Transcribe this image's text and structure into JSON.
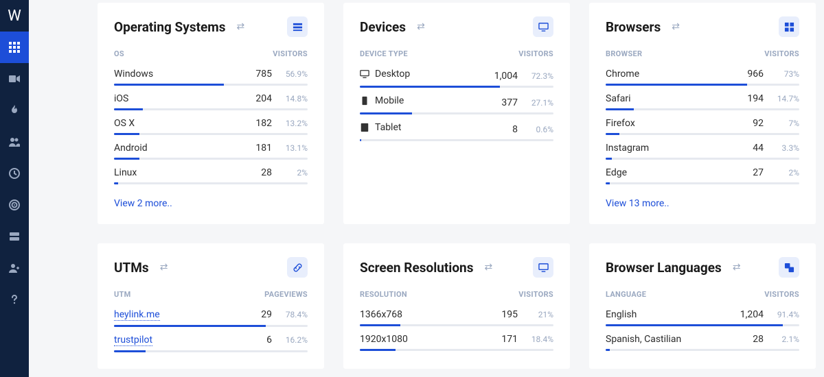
{
  "sidebar": {
    "logo": "W",
    "items": [
      {
        "id": "dashboard",
        "active": true
      },
      {
        "id": "video"
      },
      {
        "id": "fire"
      },
      {
        "id": "users"
      },
      {
        "id": "clock"
      },
      {
        "id": "target"
      },
      {
        "id": "server"
      },
      {
        "id": "user-add"
      },
      {
        "id": "help"
      }
    ]
  },
  "cards": {
    "os": {
      "title": "Operating Systems",
      "col1": "OS",
      "col2": "VISITORS",
      "rows": [
        {
          "label": "Windows",
          "value": "785",
          "pct": "56.9%",
          "w": 56.9
        },
        {
          "label": "iOS",
          "value": "204",
          "pct": "14.8%",
          "w": 14.8
        },
        {
          "label": "OS X",
          "value": "182",
          "pct": "13.2%",
          "w": 13.2
        },
        {
          "label": "Android",
          "value": "181",
          "pct": "13.1%",
          "w": 13.1
        },
        {
          "label": "Linux",
          "value": "28",
          "pct": "2%",
          "w": 2
        }
      ],
      "more": "View 2 more.."
    },
    "devices": {
      "title": "Devices",
      "col1": "DEVICE TYPE",
      "col2": "VISITORS",
      "rows": [
        {
          "label": "Desktop",
          "value": "1,004",
          "pct": "72.3%",
          "w": 72.3,
          "icon": "desktop"
        },
        {
          "label": "Mobile",
          "value": "377",
          "pct": "27.1%",
          "w": 27.1,
          "icon": "mobile"
        },
        {
          "label": "Tablet",
          "value": "8",
          "pct": "0.6%",
          "w": 0.6,
          "icon": "tablet"
        }
      ]
    },
    "browsers": {
      "title": "Browsers",
      "col1": "BROWSER",
      "col2": "VISITORS",
      "rows": [
        {
          "label": "Chrome",
          "value": "966",
          "pct": "73%",
          "w": 73
        },
        {
          "label": "Safari",
          "value": "194",
          "pct": "14.7%",
          "w": 14.7
        },
        {
          "label": "Firefox",
          "value": "92",
          "pct": "7%",
          "w": 7
        },
        {
          "label": "Instagram",
          "value": "44",
          "pct": "3.3%",
          "w": 3.3
        },
        {
          "label": "Edge",
          "value": "27",
          "pct": "2%",
          "w": 2
        }
      ],
      "more": "View 13 more.."
    },
    "utms": {
      "title": "UTMs",
      "col1": "UTM",
      "col2": "PAGEVIEWS",
      "rows": [
        {
          "label": "heylink.me",
          "value": "29",
          "pct": "78.4%",
          "w": 78.4,
          "link": true
        },
        {
          "label": "trustpilot",
          "value": "6",
          "pct": "16.2%",
          "w": 16.2,
          "link": true
        }
      ]
    },
    "resolutions": {
      "title": "Screen Resolutions",
      "col1": "RESOLUTION",
      "col2": "VISITORS",
      "rows": [
        {
          "label": "1366x768",
          "value": "195",
          "pct": "21%",
          "w": 21
        },
        {
          "label": "1920x1080",
          "value": "171",
          "pct": "18.4%",
          "w": 18.4
        }
      ]
    },
    "languages": {
      "title": "Browser Languages",
      "col1": "LANGUAGE",
      "col2": "VISITORS",
      "rows": [
        {
          "label": "English",
          "value": "1,204",
          "pct": "91.4%",
          "w": 91.4
        },
        {
          "label": "Spanish, Castilian",
          "value": "28",
          "pct": "2.1%",
          "w": 2.1
        }
      ]
    }
  }
}
